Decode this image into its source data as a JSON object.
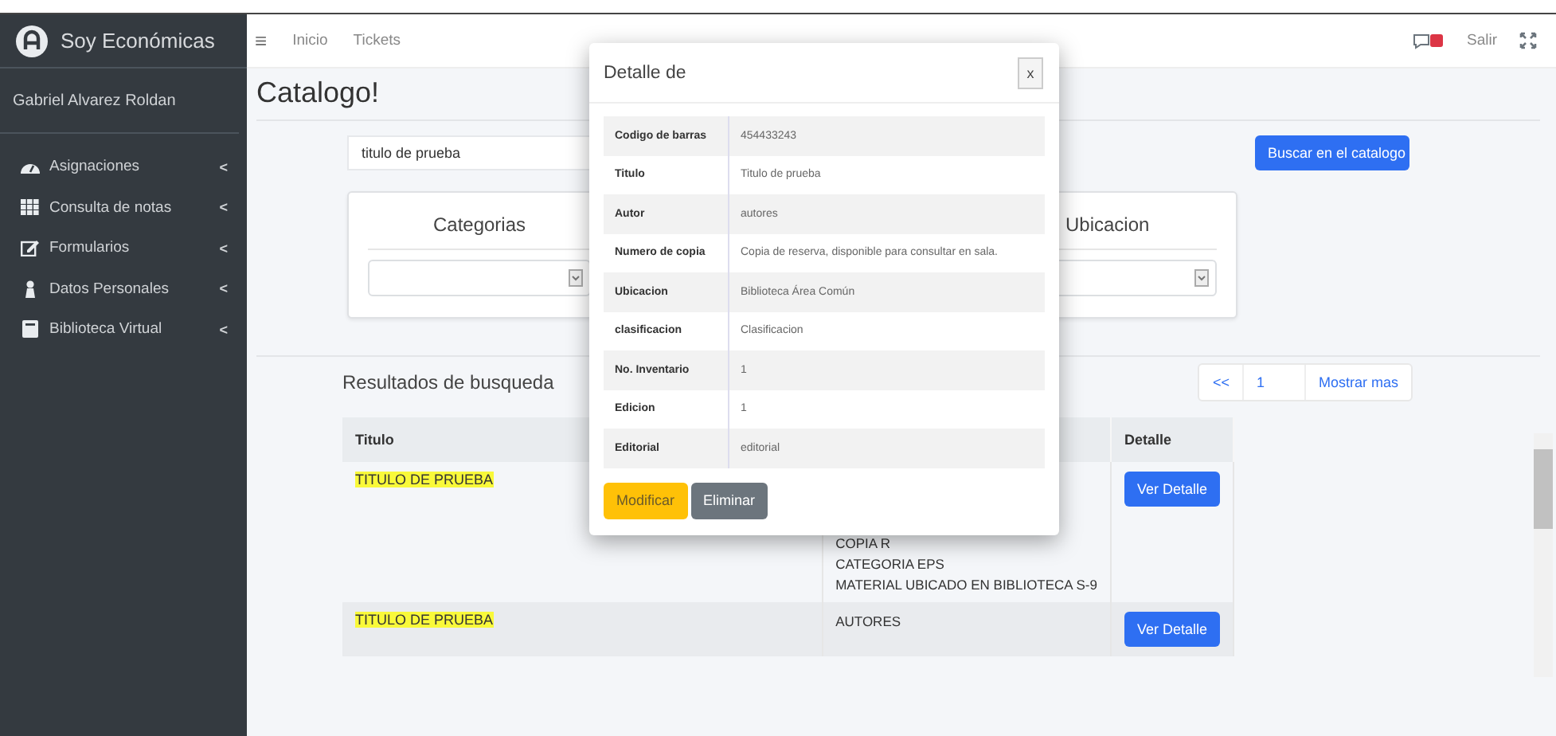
{
  "sidebar": {
    "brand": "Soy Económicas",
    "user": "Gabriel Alvarez Roldan",
    "items": [
      {
        "label": "Asignaciones",
        "expand": "<"
      },
      {
        "label": "Consulta de notas",
        "expand": "<"
      },
      {
        "label": "Formularios",
        "expand": "<"
      },
      {
        "label": "Datos Personales",
        "expand": "<"
      },
      {
        "label": "Biblioteca Virtual",
        "expand": "<"
      }
    ]
  },
  "header": {
    "menu_icon": "≡",
    "links": [
      "Inicio",
      "Tickets"
    ],
    "logout": "Salir"
  },
  "page": {
    "title": "Catalogo!",
    "search": {
      "value": "titulo de prueba"
    },
    "search_button": "Buscar en el catalogo",
    "filters": [
      {
        "title": "Categorias"
      },
      {
        "title": "Ubicacion"
      }
    ],
    "results_title": "Resultados de busqueda",
    "pagination": [
      {
        "label": "<<"
      },
      {
        "label": "1"
      },
      {
        "label": "Mostrar mas"
      }
    ],
    "table": {
      "columns": [
        "Titulo",
        "",
        "Detalle"
      ],
      "rows": [
        {
          "title": "TITULO DE PRUEBA",
          "column_2": [
            "COPIA R",
            "CATEGORIA EPS",
            "MATERIAL UBICADO EN BIBLIOTECA S-9"
          ],
          "action": "Ver Detalle"
        },
        {
          "title": "TITULO DE PRUEBA",
          "column_2": [
            "AUTORES"
          ],
          "action": "Ver Detalle"
        }
      ]
    }
  },
  "modal": {
    "title": "Detalle de",
    "close": "x",
    "fields": [
      {
        "label": "Codigo de barras",
        "value": "454433243"
      },
      {
        "label": "Titulo",
        "value": "Titulo de prueba"
      },
      {
        "label": "Autor",
        "value": "autores"
      },
      {
        "label": "Numero de copia",
        "value": "Copia de reserva, disponible para consultar en sala."
      },
      {
        "label": "Ubicacion",
        "value": "Biblioteca Área Común"
      },
      {
        "label": "clasificacion",
        "value": "Clasificacion"
      },
      {
        "label": "No. Inventario",
        "value": "1"
      },
      {
        "label": "Edicion",
        "value": "1"
      },
      {
        "label": "Editorial",
        "value": "editorial"
      }
    ],
    "buttons": [
      {
        "label": "Modificar",
        "kind": "warning"
      },
      {
        "label": "Eliminar",
        "kind": "secondary"
      }
    ]
  }
}
